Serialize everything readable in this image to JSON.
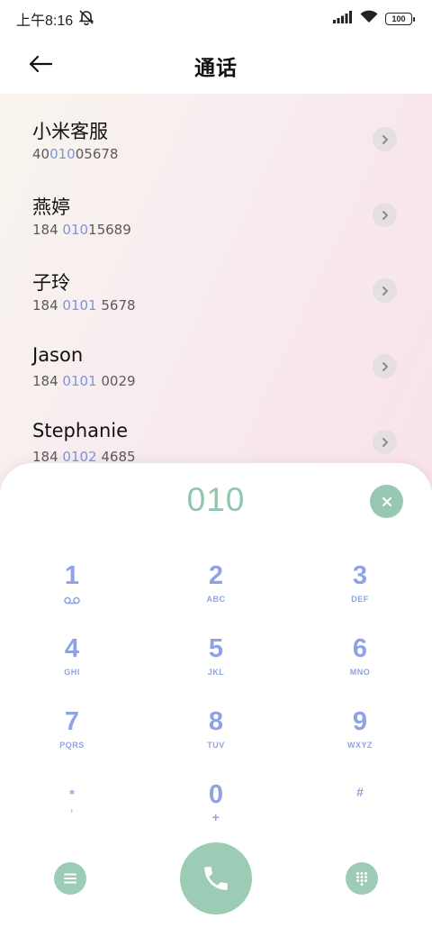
{
  "status_bar": {
    "time": "上午8:16",
    "battery": "100"
  },
  "header": {
    "title": "通话"
  },
  "results": [
    {
      "name": "小米客服",
      "num_pre": "40",
      "num_match": "010",
      "num_post": "05678"
    },
    {
      "name": "燕婷",
      "num_pre": "184 ",
      "num_match": "010",
      "num_post": "15689"
    },
    {
      "name": "子玲",
      "num_pre": "184 ",
      "num_match": "0101",
      "num_post": " 5678"
    },
    {
      "name": "Jason",
      "num_pre": "184 ",
      "num_match": "0101",
      "num_post": " 0029"
    },
    {
      "name": "Stephanie",
      "num_pre": "184 ",
      "num_match": "0102",
      "num_post": " 4685"
    }
  ],
  "dialpad": {
    "typed": "010",
    "keys": [
      {
        "digit": "1",
        "letters": ""
      },
      {
        "digit": "2",
        "letters": "ABC"
      },
      {
        "digit": "3",
        "letters": "DEF"
      },
      {
        "digit": "4",
        "letters": "GHI"
      },
      {
        "digit": "5",
        "letters": "JKL"
      },
      {
        "digit": "6",
        "letters": "MNO"
      },
      {
        "digit": "7",
        "letters": "PQRS"
      },
      {
        "digit": "8",
        "letters": "TUV"
      },
      {
        "digit": "9",
        "letters": "WXYZ"
      },
      {
        "digit": "*",
        "letters": ","
      },
      {
        "digit": "0",
        "letters": "+"
      },
      {
        "digit": "#",
        "letters": ""
      }
    ]
  },
  "icons": {
    "back": "arrow-left-icon",
    "mute": "bell-muted-icon",
    "signal": "signal-icon",
    "wifi": "wifi-icon",
    "voicemail": "voicemail-icon",
    "clear": "close-icon",
    "menu": "menu-icon",
    "call": "phone-icon",
    "keypad": "keypad-icon"
  },
  "colors": {
    "accent_green": "#9ccbb6",
    "digit_blue": "#8fa2e6",
    "match_blue": "#7f93dc"
  }
}
